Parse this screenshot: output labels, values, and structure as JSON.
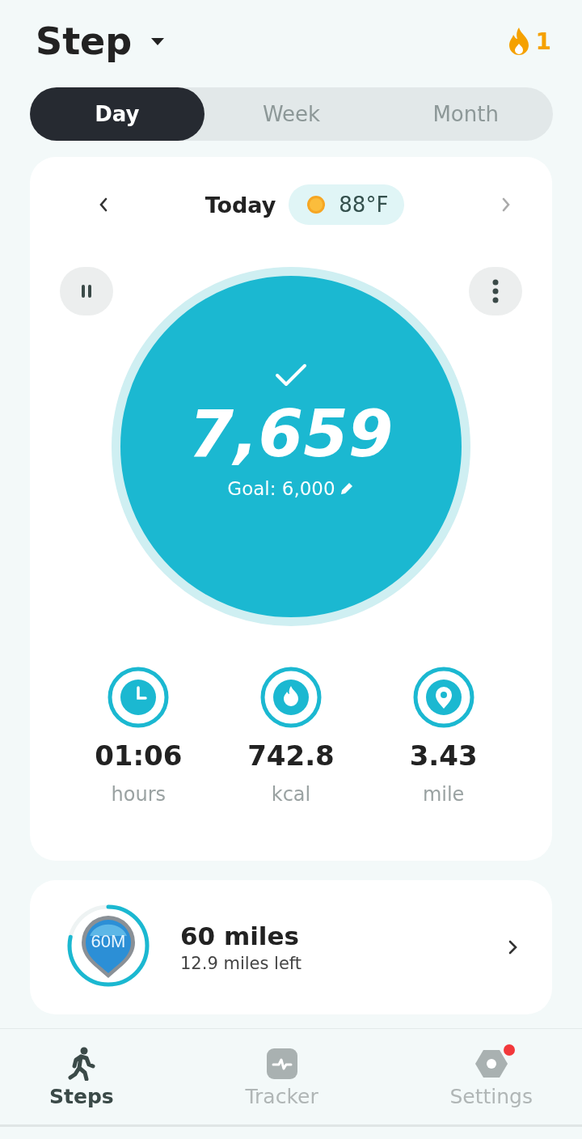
{
  "header": {
    "title": "Step",
    "streak": "1"
  },
  "tabs": [
    {
      "label": "Day",
      "selected": true
    },
    {
      "label": "Week",
      "selected": false
    },
    {
      "label": "Month",
      "selected": false
    }
  ],
  "day_card": {
    "date": "Today",
    "temperature": "88°F",
    "goal_reached": true,
    "steps": "7,659",
    "goal": "Goal: 6,000",
    "stats": [
      {
        "kind": "clock",
        "value": "01:06",
        "unit": "hours"
      },
      {
        "kind": "flame",
        "value": "742.8",
        "unit": "kcal"
      },
      {
        "kind": "pin",
        "value": "3.43",
        "unit": "mile"
      }
    ]
  },
  "challenge": {
    "badge_label": "60M",
    "title": "60 miles",
    "subtitle": "12.9 miles left"
  },
  "nav": [
    {
      "label": "Steps",
      "kind": "steps",
      "selected": true,
      "notification": false
    },
    {
      "label": "Tracker",
      "kind": "tracker",
      "selected": false,
      "notification": false
    },
    {
      "label": "Settings",
      "kind": "settings",
      "selected": false,
      "notification": true
    }
  ]
}
